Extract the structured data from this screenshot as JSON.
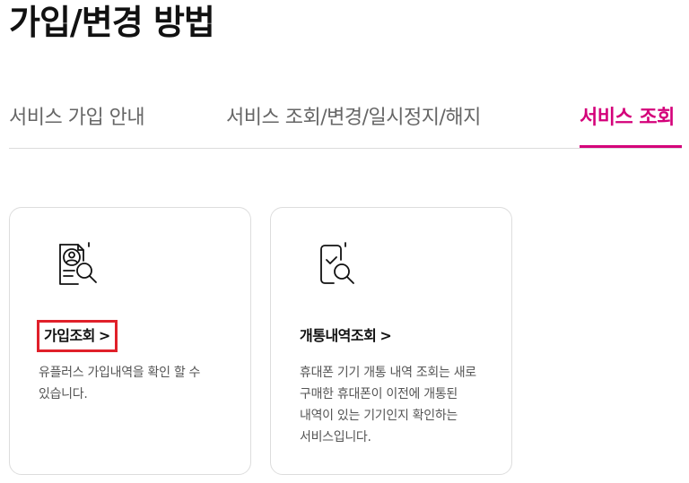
{
  "page": {
    "title": "가입/변경 방법"
  },
  "tabs": [
    {
      "label": "서비스 가입 안내",
      "active": false
    },
    {
      "label": "서비스 조회/변경/일시정지/해지",
      "active": false
    },
    {
      "label": "서비스 조회",
      "active": true
    }
  ],
  "cards": [
    {
      "title": "가입조회",
      "chevron": ">",
      "description": "유플러스 가입내역을 확인 할 수 있습니다.",
      "icon": "document-profile-search-icon"
    },
    {
      "title": "개통내역조회",
      "chevron": ">",
      "description": "휴대폰 기기 개통 내역 조회는 새로 구매한 휴대폰이 이전에 개통된 내역이 있는 기기인지 확인하는 서비스입니다.",
      "icon": "phone-check-search-icon"
    }
  ],
  "colors": {
    "accent": "#d4007a",
    "highlight_border": "#e0202a",
    "tab_inactive": "#666666",
    "description_text": "#555555"
  }
}
